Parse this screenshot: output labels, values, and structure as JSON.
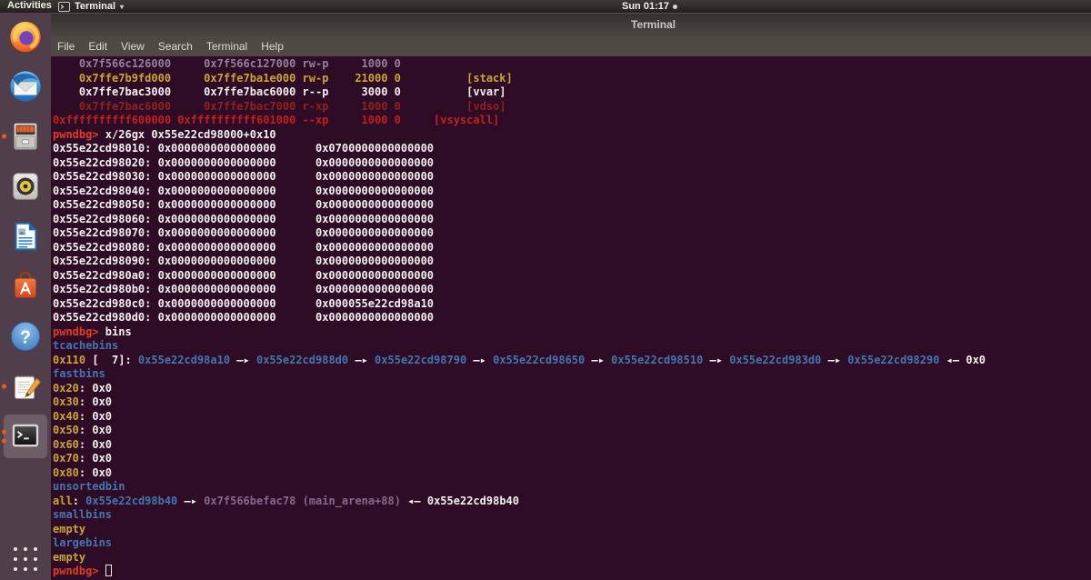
{
  "top_bar": {
    "activities": "Activities",
    "app_label": "Terminal",
    "caret": "▾",
    "clock": "Sun 01:17"
  },
  "window": {
    "title": "Terminal",
    "menus": [
      "File",
      "Edit",
      "View",
      "Search",
      "Terminal",
      "Help"
    ]
  },
  "dock": {
    "items": [
      {
        "name": "firefox",
        "indicators": 0
      },
      {
        "name": "thunderbird",
        "indicators": 0
      },
      {
        "name": "files",
        "indicators": 1
      },
      {
        "name": "rhythmbox",
        "indicators": 0
      },
      {
        "name": "libreoffice-writer",
        "indicators": 0
      },
      {
        "name": "ubuntu-software",
        "indicators": 0
      },
      {
        "name": "help",
        "indicators": 0
      },
      {
        "name": "text-editor",
        "indicators": 1
      },
      {
        "name": "terminal",
        "indicators": 2,
        "active": true
      }
    ]
  },
  "terminal": {
    "lines": [
      [
        {
          "t": "    0x7f566c126000     0x7f566c127000 rw-p     1000 0",
          "c": "mut"
        }
      ],
      [
        {
          "t": "    0x7ffe7b9fd000     0x7ffe7ba1e000 rw-p    21000 0          [stack]",
          "c": "yel"
        }
      ],
      [
        {
          "t": "    0x7ffe7bac3000     0x7ffe7bac6000 r--p     3000 0          [vvar]",
          "c": "wht"
        }
      ],
      [
        {
          "t": "    0x7ffe7bac6000     0x7ffe7bac7000 r-xp     1000 0          [vdso]",
          "c": "dred"
        }
      ],
      [
        {
          "t": "0xffffffffff600000 0xffffffffff601000 --xp     1000 0     [vsyscall]",
          "c": "red"
        }
      ],
      [
        {
          "t": "pwndbg> ",
          "c": "prm"
        },
        {
          "t": "x/26gx 0x55e22cd98000+0x10",
          "c": "wht"
        }
      ],
      [
        {
          "t": "0x55e22cd98010: 0x0000000000000000      0x0700000000000000",
          "c": "wht"
        }
      ],
      [
        {
          "t": "0x55e22cd98020: 0x0000000000000000      0x0000000000000000",
          "c": "wht"
        }
      ],
      [
        {
          "t": "0x55e22cd98030: 0x0000000000000000      0x0000000000000000",
          "c": "wht"
        }
      ],
      [
        {
          "t": "0x55e22cd98040: 0x0000000000000000      0x0000000000000000",
          "c": "wht"
        }
      ],
      [
        {
          "t": "0x55e22cd98050: 0x0000000000000000      0x0000000000000000",
          "c": "wht"
        }
      ],
      [
        {
          "t": "0x55e22cd98060: 0x0000000000000000      0x0000000000000000",
          "c": "wht"
        }
      ],
      [
        {
          "t": "0x55e22cd98070: 0x0000000000000000      0x0000000000000000",
          "c": "wht"
        }
      ],
      [
        {
          "t": "0x55e22cd98080: 0x0000000000000000      0x0000000000000000",
          "c": "wht"
        }
      ],
      [
        {
          "t": "0x55e22cd98090: 0x0000000000000000      0x0000000000000000",
          "c": "wht"
        }
      ],
      [
        {
          "t": "0x55e22cd980a0: 0x0000000000000000      0x0000000000000000",
          "c": "wht"
        }
      ],
      [
        {
          "t": "0x55e22cd980b0: 0x0000000000000000      0x0000000000000000",
          "c": "wht"
        }
      ],
      [
        {
          "t": "0x55e22cd980c0: 0x0000000000000000      0x000055e22cd98a10",
          "c": "wht"
        }
      ],
      [
        {
          "t": "0x55e22cd980d0: 0x0000000000000000      0x0000000000000000",
          "c": "wht"
        }
      ],
      [
        {
          "t": "pwndbg> ",
          "c": "prm"
        },
        {
          "t": "bins",
          "c": "wht"
        }
      ],
      [
        {
          "t": "tcachebins",
          "c": "blu"
        }
      ],
      [
        {
          "t": "0x110",
          "c": "yel"
        },
        {
          "t": " [  7]: ",
          "c": "wht"
        },
        {
          "t": "0x55e22cd98a10",
          "c": "blu"
        },
        {
          "t": " —▸ ",
          "c": "wht"
        },
        {
          "t": "0x55e22cd988d0",
          "c": "blu"
        },
        {
          "t": " —▸ ",
          "c": "wht"
        },
        {
          "t": "0x55e22cd98790",
          "c": "blu"
        },
        {
          "t": " —▸ ",
          "c": "wht"
        },
        {
          "t": "0x55e22cd98650",
          "c": "blu"
        },
        {
          "t": " —▸ ",
          "c": "wht"
        },
        {
          "t": "0x55e22cd98510",
          "c": "blu"
        },
        {
          "t": " —▸ ",
          "c": "wht"
        },
        {
          "t": "0x55e22cd983d0",
          "c": "blu"
        },
        {
          "t": " —▸ ",
          "c": "wht"
        },
        {
          "t": "0x55e22cd98290",
          "c": "blu"
        },
        {
          "t": " ◂— 0x0",
          "c": "wht"
        }
      ],
      [
        {
          "t": "fastbins",
          "c": "blu"
        }
      ],
      [
        {
          "t": "0x20",
          "c": "yel"
        },
        {
          "t": ": 0x0",
          "c": "wht"
        }
      ],
      [
        {
          "t": "0x30",
          "c": "yel"
        },
        {
          "t": ": 0x0",
          "c": "wht"
        }
      ],
      [
        {
          "t": "0x40",
          "c": "yel"
        },
        {
          "t": ": 0x0",
          "c": "wht"
        }
      ],
      [
        {
          "t": "0x50",
          "c": "yel"
        },
        {
          "t": ": 0x0",
          "c": "wht"
        }
      ],
      [
        {
          "t": "0x60",
          "c": "yel"
        },
        {
          "t": ": 0x0",
          "c": "wht"
        }
      ],
      [
        {
          "t": "0x70",
          "c": "yel"
        },
        {
          "t": ": 0x0",
          "c": "wht"
        }
      ],
      [
        {
          "t": "0x80",
          "c": "yel"
        },
        {
          "t": ": 0x0",
          "c": "wht"
        }
      ],
      [
        {
          "t": "unsortedbin",
          "c": "blu"
        }
      ],
      [
        {
          "t": "all",
          "c": "yel"
        },
        {
          "t": ": ",
          "c": "wht"
        },
        {
          "t": "0x55e22cd98b40",
          "c": "blu"
        },
        {
          "t": " —▸ ",
          "c": "wht"
        },
        {
          "t": "0x7f566befac78 (main_arena+88)",
          "c": "pur"
        },
        {
          "t": " ◂— 0x55e22cd98b40",
          "c": "wht"
        }
      ],
      [
        {
          "t": "smallbins",
          "c": "blu"
        }
      ],
      [
        {
          "t": "empty",
          "c": "yel"
        }
      ],
      [
        {
          "t": "largebins",
          "c": "blu"
        }
      ],
      [
        {
          "t": "empty",
          "c": "yel"
        }
      ],
      [
        {
          "t": "pwndbg> ",
          "c": "prm"
        },
        {
          "t": "",
          "c": "cur"
        }
      ]
    ]
  }
}
